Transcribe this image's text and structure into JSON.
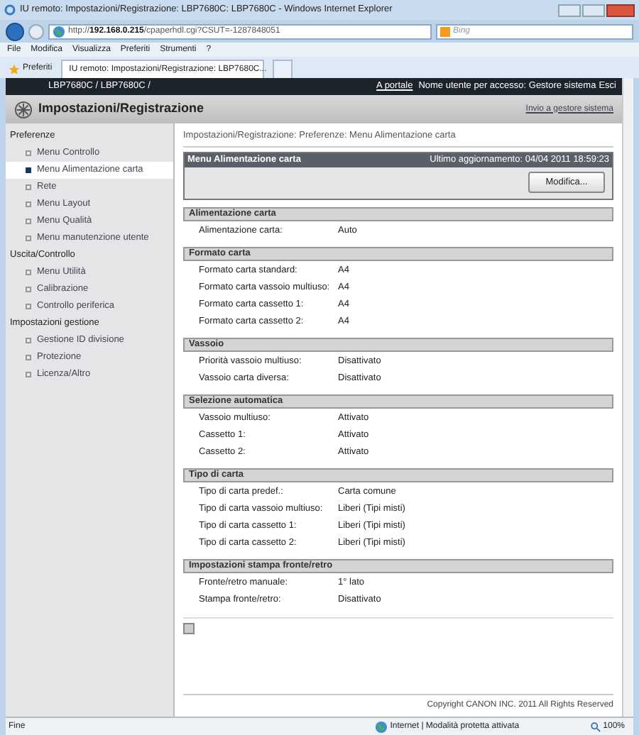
{
  "window": {
    "title": "IU remoto: Impostazioni/Registrazione: LBP7680C: LBP7680C - Windows Internet Explorer"
  },
  "address_bar": {
    "url_prefix": "http://",
    "url_host": "192.168.0.215",
    "url_path": "/cpaperhdl.cgi?CSUT=-1287848051",
    "search_placeholder": "Bing"
  },
  "menu_bar": [
    "File",
    "Modifica",
    "Visualizza",
    "Preferiti",
    "Strumenti",
    "?"
  ],
  "favorites_bar": {
    "label": "Preferiti",
    "tab_title": "IU remoto: Impostazioni/Registrazione: LBP7680C..."
  },
  "page_header": {
    "device": "LBP7680C / LBP7680C /",
    "portal_link": "A portale",
    "user": "Nome utente per accesso: Gestore sistema",
    "logout": "Esci",
    "title": "Impostazioni/Registrazione",
    "admin_link": "Invio a gestore sistema"
  },
  "sidebar": [
    {
      "heading": "Preferenze",
      "items": [
        {
          "label": "Menu Controllo",
          "selected": false
        },
        {
          "label": "Menu Alimentazione carta",
          "selected": true
        },
        {
          "label": "Rete",
          "selected": false
        },
        {
          "label": "Menu Layout",
          "selected": false
        },
        {
          "label": "Menu Qualità",
          "selected": false
        },
        {
          "label": "Menu manutenzione utente",
          "selected": false
        }
      ]
    },
    {
      "heading": "Uscita/Controllo",
      "items": [
        {
          "label": "Menu Utilità",
          "selected": false
        },
        {
          "label": "Calibrazione",
          "selected": false
        },
        {
          "label": "Controllo periferica",
          "selected": false
        }
      ]
    },
    {
      "heading": "Impostazioni gestione",
      "items": [
        {
          "label": "Gestione ID divisione",
          "selected": false
        },
        {
          "label": "Protezione",
          "selected": false
        },
        {
          "label": "Licenza/Altro",
          "selected": false
        }
      ]
    }
  ],
  "breadcrumb": "Impostazioni/Registrazione: Preferenze: Menu Alimentazione carta",
  "panel": {
    "title": "Menu Alimentazione carta",
    "updated": "Ultimo aggiornamento: 04/04 2011 18:59:23",
    "button": "Modifica..."
  },
  "sections": [
    {
      "title": "Alimentazione carta",
      "rows": [
        [
          "Alimentazione carta:",
          "Auto"
        ]
      ]
    },
    {
      "title": "Formato carta",
      "rows": [
        [
          "Formato carta standard:",
          "A4"
        ],
        [
          "Formato carta vassoio multiuso:",
          "A4"
        ],
        [
          "Formato carta cassetto 1:",
          "A4"
        ],
        [
          "Formato carta cassetto 2:",
          "A4"
        ]
      ]
    },
    {
      "title": "Vassoio",
      "rows": [
        [
          "Priorità vassoio multiuso:",
          "Disattivato"
        ],
        [
          "Vassoio carta diversa:",
          "Disattivato"
        ]
      ]
    },
    {
      "title": "Selezione automatica",
      "rows": [
        [
          "Vassoio multiuso:",
          "Attivato"
        ],
        [
          "Cassetto 1:",
          "Attivato"
        ],
        [
          "Cassetto 2:",
          "Attivato"
        ]
      ]
    },
    {
      "title": "Tipo di carta",
      "rows": [
        [
          "Tipo di carta predef.:",
          "Carta comune"
        ],
        [
          "Tipo di carta vassoio multiuso:",
          "Liberi (Tipi misti)"
        ],
        [
          "Tipo di carta cassetto 1:",
          "Liberi (Tipi misti)"
        ],
        [
          "Tipo di carta cassetto 2:",
          "Liberi (Tipi misti)"
        ]
      ]
    },
    {
      "title": "Impostazioni stampa fronte/retro",
      "rows": [
        [
          "Fronte/retro manuale:",
          "1° lato"
        ],
        [
          "Stampa fronte/retro:",
          "Disattivato"
        ]
      ]
    }
  ],
  "footer": "Copyright CANON INC. 2011 All Rights Reserved",
  "status_bar": {
    "status": "Fine",
    "zone": "Internet | Modalità protetta attivata",
    "zoom": "100%"
  }
}
